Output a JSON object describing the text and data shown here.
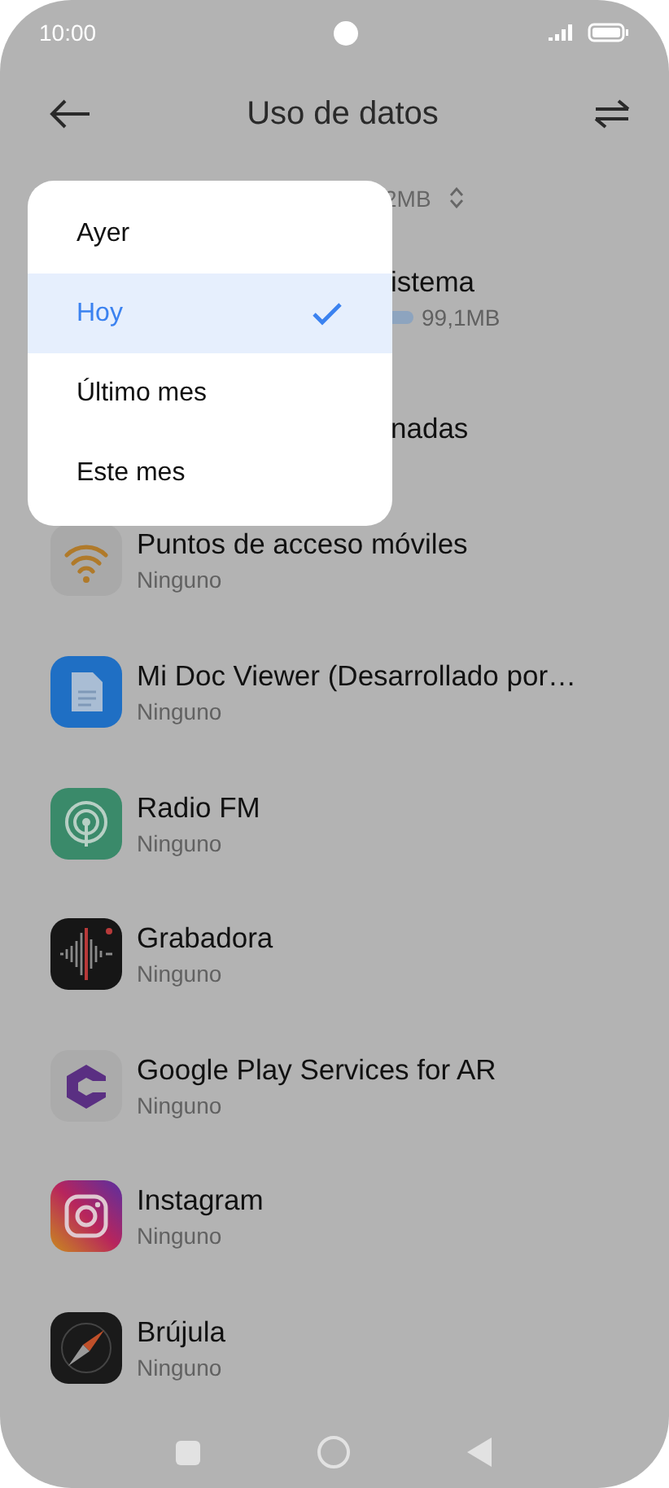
{
  "status_bar": {
    "time": "10:00"
  },
  "header": {
    "title": "Uso de datos"
  },
  "summary": {
    "total": "2MB"
  },
  "apps": [
    {
      "kind": "covered",
      "name": "istema",
      "usage": "99,1MB"
    },
    {
      "kind": "covered",
      "name": "nadas"
    },
    {
      "kind": "app",
      "name": "Puntos de acceso móviles",
      "usage": "Ninguno"
    },
    {
      "kind": "app",
      "name": "Mi Doc Viewer (Desarrollado por…",
      "usage": "Ninguno"
    },
    {
      "kind": "app",
      "name": "Radio FM",
      "usage": "Ninguno"
    },
    {
      "kind": "app",
      "name": "Grabadora",
      "usage": "Ninguno"
    },
    {
      "kind": "app",
      "name": "Google Play Services for AR",
      "usage": "Ninguno"
    },
    {
      "kind": "app",
      "name": "Instagram",
      "usage": "Ninguno"
    },
    {
      "kind": "app",
      "name": "Brújula",
      "usage": "Ninguno"
    }
  ],
  "period_menu": {
    "options": [
      {
        "label": "Ayer",
        "selected": false
      },
      {
        "label": "Hoy",
        "selected": true
      },
      {
        "label": "Último mes",
        "selected": false
      },
      {
        "label": "Este mes",
        "selected": false
      }
    ]
  }
}
